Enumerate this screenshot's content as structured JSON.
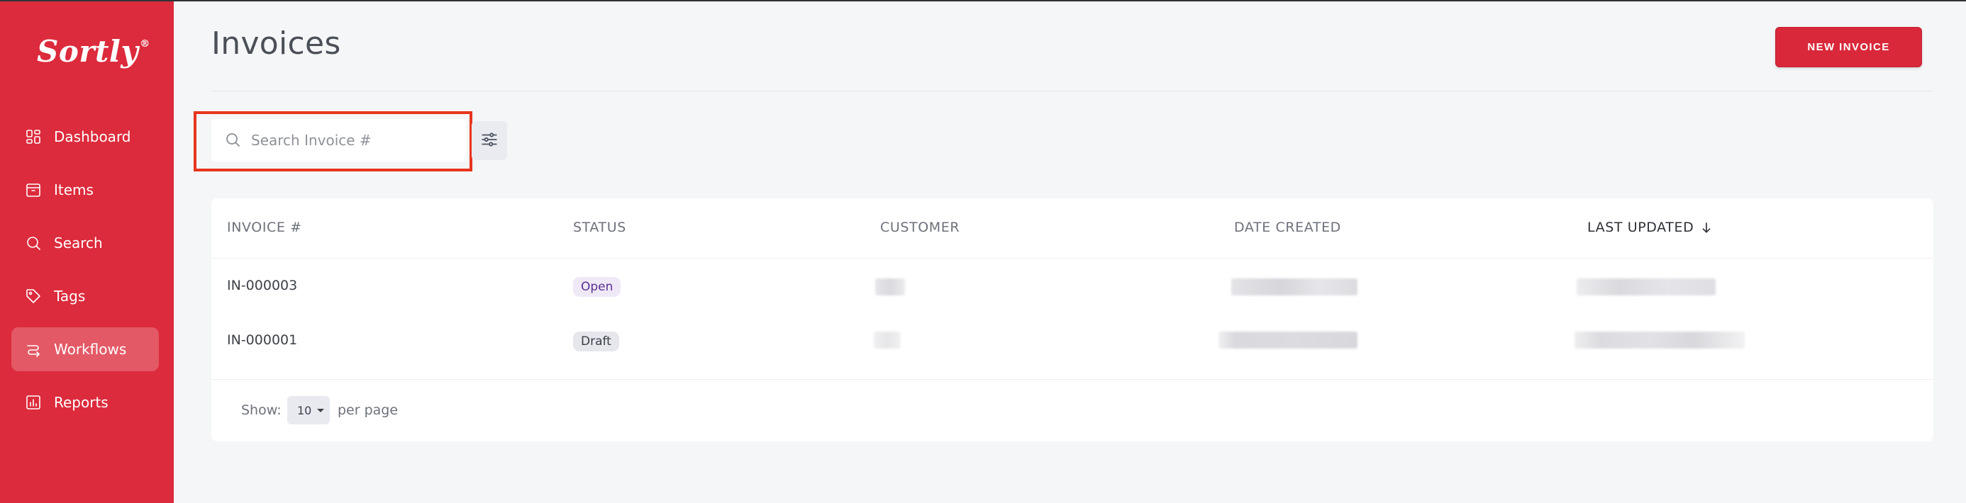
{
  "app": {
    "logo_text": "Sortly",
    "logo_mark": "®"
  },
  "sidebar": {
    "items": [
      {
        "label": "Dashboard",
        "icon": "dashboard-icon",
        "active": false
      },
      {
        "label": "Items",
        "icon": "items-icon",
        "active": false
      },
      {
        "label": "Search",
        "icon": "search-icon",
        "active": false
      },
      {
        "label": "Tags",
        "icon": "tag-icon",
        "active": false
      },
      {
        "label": "Workflows",
        "icon": "workflows-icon",
        "active": true
      },
      {
        "label": "Reports",
        "icon": "reports-icon",
        "active": false
      }
    ]
  },
  "header": {
    "title": "Invoices",
    "new_button_label": "NEW INVOICE"
  },
  "search": {
    "placeholder": "Search Invoice #",
    "value": ""
  },
  "table": {
    "columns": [
      "INVOICE #",
      "STATUS",
      "CUSTOMER",
      "DATE CREATED",
      "LAST UPDATED"
    ],
    "sorted_column": "LAST UPDATED",
    "sort_direction": "descending",
    "rows": [
      {
        "invoice": "IN-000003",
        "status": "Open"
      },
      {
        "invoice": "IN-000001",
        "status": "Draft"
      }
    ]
  },
  "pagination": {
    "show_label": "Show:",
    "per_page_value": "10",
    "per_page_label": "per page"
  },
  "colors": {
    "sidebar_bg": "#dc2b3c",
    "accent_button": "#d9283a",
    "highlight_frame": "#e8351f",
    "badge_open_bg": "#efe9f7",
    "badge_open_text": "#5a2e91",
    "badge_draft_bg": "#e6e7ec"
  }
}
